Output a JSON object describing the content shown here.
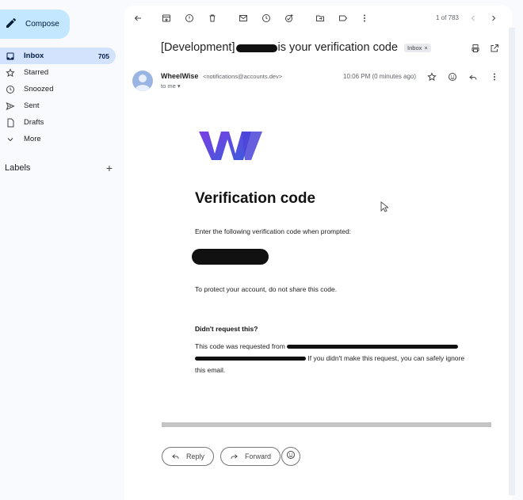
{
  "sidebar": {
    "compose_label": "Compose",
    "items": [
      {
        "label": "Inbox",
        "count": "705",
        "icon": "inbox-icon"
      },
      {
        "label": "Starred",
        "icon": "star-icon"
      },
      {
        "label": "Snoozed",
        "icon": "clock-icon"
      },
      {
        "label": "Sent",
        "icon": "send-icon"
      },
      {
        "label": "Drafts",
        "icon": "draft-icon"
      },
      {
        "label": "More",
        "icon": "chevron-down-icon"
      }
    ],
    "labels_heading": "Labels"
  },
  "toolbar": {
    "pager": "1 of 783"
  },
  "email": {
    "subject_prefix": "[Development]",
    "subject_suffix": "is your verification code",
    "inbox_chip": "Inbox",
    "sender_name": "WheelWise",
    "sender_email": "<notifications@accounts.dev>",
    "to": "to me",
    "time": "10:06 PM (0 minutes ago)",
    "body": {
      "heading": "Verification code",
      "instruction": "Enter the following verification code when prompted:",
      "warning": "To protect your account, do not share this code.",
      "didnt_request": "Didn't request this?",
      "detail_prefix": "This code was requested from",
      "detail_suffix": "If you didn't make this request, you can safely ignore this email."
    }
  },
  "actions": {
    "reply": "Reply",
    "forward": "Forward"
  },
  "colors": {
    "accent": "#c2e7ff",
    "active_nav": "#d3e3fd",
    "logo_purple": "#7b3fe4",
    "logo_blue": "#3b5bdb"
  }
}
